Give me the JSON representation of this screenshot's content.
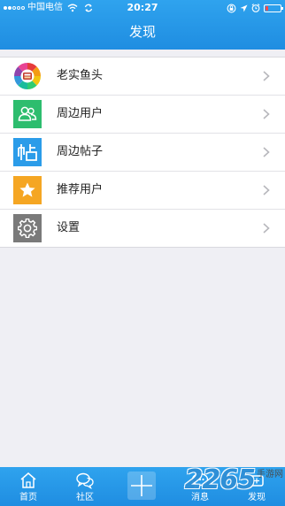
{
  "status_bar": {
    "carrier": "中国电信",
    "time": "20:27",
    "signal_strength": 2,
    "battery_level": 0.2,
    "battery_color": "#ff4b4b"
  },
  "header": {
    "title": "发现",
    "background": "#2196e6"
  },
  "menu": {
    "items": [
      {
        "label": "老实鱼头",
        "icon": "app-logo-icon"
      },
      {
        "label": "周边用户",
        "icon": "users-icon",
        "color": "#2dbd6e"
      },
      {
        "label": "周边帖子",
        "icon": "post-tie-icon",
        "color": "#2b9ce9"
      },
      {
        "label": "推荐用户",
        "icon": "star-icon",
        "color": "#f5a623"
      },
      {
        "label": "设置",
        "icon": "gear-icon",
        "color": "#7a7a7a"
      }
    ]
  },
  "tabs": [
    {
      "label": "首页",
      "icon": "home-icon"
    },
    {
      "label": "社区",
      "icon": "chat-bubbles-icon"
    },
    {
      "label": "",
      "icon": "plus-icon"
    },
    {
      "label": "消息",
      "icon": "message-icon"
    },
    {
      "label": "发现",
      "icon": "discover-icon"
    }
  ],
  "watermark": {
    "number": "2265",
    "text": "手游网"
  }
}
